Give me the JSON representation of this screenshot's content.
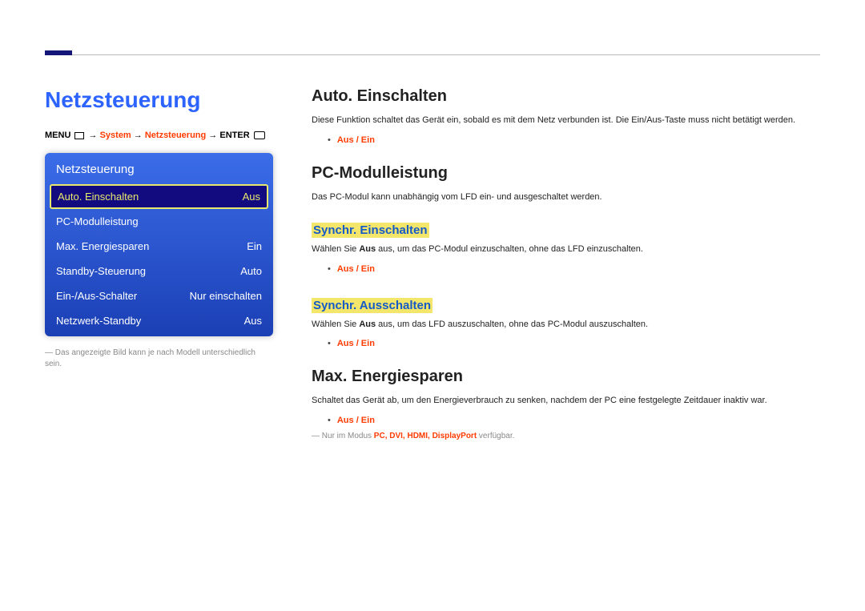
{
  "page_title": "Netzsteuerung",
  "breadcrumb": {
    "menu": "MENU",
    "path1": "System",
    "path2": "Netzsteuerung",
    "enter": "ENTER"
  },
  "menu_panel": {
    "header": "Netzsteuerung",
    "rows": [
      {
        "label": "Auto. Einschalten",
        "value": "Aus",
        "selected": true
      },
      {
        "label": "PC-Modulleistung",
        "value": "",
        "selected": false
      },
      {
        "label": "Max. Energiesparen",
        "value": "Ein",
        "selected": false
      },
      {
        "label": "Standby-Steuerung",
        "value": "Auto",
        "selected": false
      },
      {
        "label": "Ein-/Aus-Schalter",
        "value": "Nur einschalten",
        "selected": false
      },
      {
        "label": "Netzwerk-Standby",
        "value": "Aus",
        "selected": false
      }
    ]
  },
  "caption": "Das angezeigte Bild kann je nach Modell unterschiedlich sein.",
  "sections": {
    "auto_ein": {
      "title": "Auto. Einschalten",
      "desc": "Diese Funktion schaltet das Gerät ein, sobald es mit dem Netz verbunden ist. Die Ein/Aus-Taste muss nicht betätigt werden.",
      "opts": "Aus / Ein"
    },
    "pc_modul": {
      "title": "PC-Modulleistung",
      "desc": "Das PC-Modul kann unabhängig vom LFD ein- und ausgeschaltet werden."
    },
    "sync_ein": {
      "title": "Synchr. Einschalten",
      "desc_pre": "Wählen Sie ",
      "desc_em": "Aus",
      "desc_post": " aus, um das PC-Modul einzuschalten, ohne das LFD einzuschalten.",
      "opts": "Aus / Ein"
    },
    "sync_aus": {
      "title": "Synchr. Ausschalten",
      "desc_pre": "Wählen Sie ",
      "desc_em": "Aus",
      "desc_post": " aus, um das LFD auszuschalten, ohne das PC-Modul auszuschalten.",
      "opts": "Aus / Ein"
    },
    "max_energ": {
      "title": "Max. Energiesparen",
      "desc": "Schaltet das Gerät ab, um den Energieverbrauch zu senken, nachdem der PC eine festgelegte Zeitdauer inaktiv war.",
      "opts": "Aus / Ein",
      "footnote_pre": "Nur im Modus ",
      "footnote_modes": "PC, DVI, HDMI, DisplayPort",
      "footnote_post": " verfügbar."
    }
  }
}
